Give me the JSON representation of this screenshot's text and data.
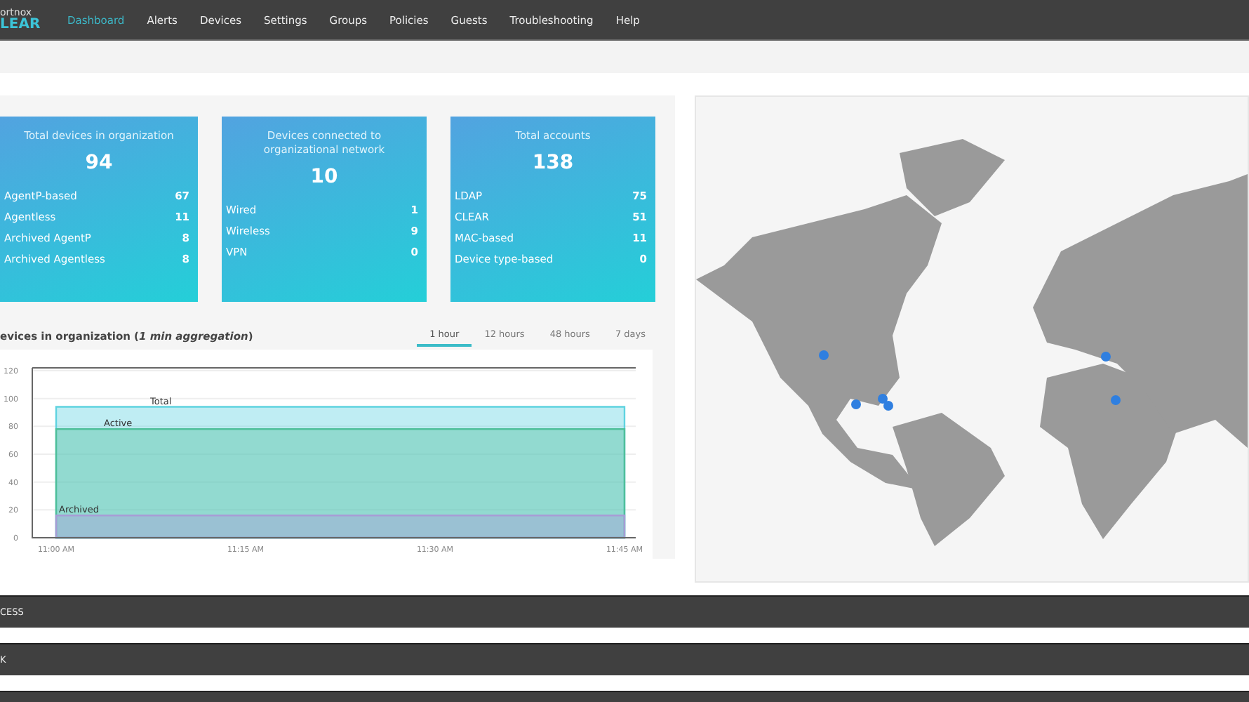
{
  "nav": {
    "logo_top": "ortnox",
    "logo_bottom": "LEAR",
    "items": [
      {
        "label": "Dashboard",
        "selected": true
      },
      {
        "label": "Alerts",
        "selected": false
      },
      {
        "label": "Devices",
        "selected": false
      },
      {
        "label": "Settings",
        "selected": false
      },
      {
        "label": "Groups",
        "selected": false
      },
      {
        "label": "Policies",
        "selected": false
      },
      {
        "label": "Guests",
        "selected": false
      },
      {
        "label": "Troubleshooting",
        "selected": false
      },
      {
        "label": "Help",
        "selected": false
      }
    ]
  },
  "cards": [
    {
      "title": "Total devices in organization",
      "total": "94",
      "rows": [
        {
          "label": "AgentP-based",
          "value": "67"
        },
        {
          "label": "Agentless",
          "value": "11"
        },
        {
          "label": "Archived AgentP",
          "value": "8"
        },
        {
          "label": "Archived Agentless",
          "value": "8"
        }
      ]
    },
    {
      "title": "Devices connected to organizational network",
      "total": "10",
      "rows": [
        {
          "label": "Wired",
          "value": "1"
        },
        {
          "label": "Wireless",
          "value": "9"
        },
        {
          "label": "VPN",
          "value": "0"
        }
      ]
    },
    {
      "title": "Total accounts",
      "total": "138",
      "rows": [
        {
          "label": "LDAP",
          "value": "75"
        },
        {
          "label": "CLEAR",
          "value": "51"
        },
        {
          "label": "MAC-based",
          "value": "11"
        },
        {
          "label": "Device type-based",
          "value": "0"
        }
      ]
    }
  ],
  "chart_panel": {
    "title": "evices in organization (*1 min aggregation*)",
    "ranges": [
      {
        "label": "1 hour",
        "selected": true
      },
      {
        "label": "12 hours",
        "selected": false
      },
      {
        "label": "48 hours",
        "selected": false
      },
      {
        "label": "7 days",
        "selected": false
      }
    ],
    "chart_data": {
      "type": "area",
      "categories": [
        "11:00 AM",
        "11:15 AM",
        "11:30 AM",
        "11:45 AM"
      ],
      "series": [
        {
          "name": "Total",
          "color": "#5fd3e0",
          "values": [
            94,
            94,
            94,
            94
          ]
        },
        {
          "name": "Active",
          "color": "#4fbf9a",
          "values": [
            78,
            78,
            78,
            78
          ]
        },
        {
          "name": "Archived",
          "color": "#a89cd6",
          "values": [
            16,
            16,
            16,
            16
          ]
        }
      ],
      "ylim": [
        0,
        120
      ],
      "yticks": [
        0,
        20,
        40,
        60,
        80,
        100,
        120
      ],
      "grid": true
    }
  },
  "sections": [
    {
      "label": "CESS"
    },
    {
      "label": "K"
    }
  ]
}
